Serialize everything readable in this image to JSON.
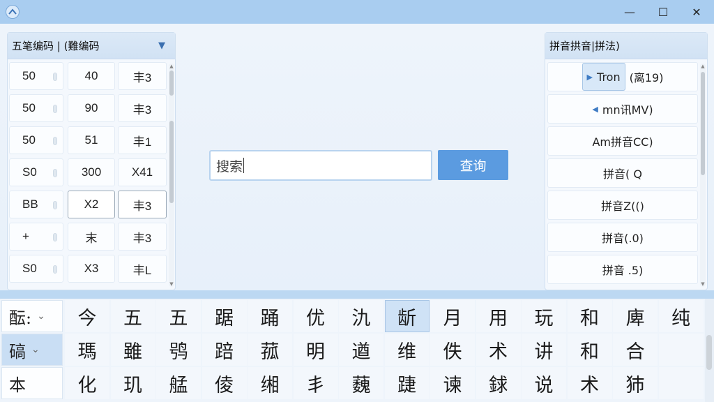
{
  "window": {
    "minimize_glyph": "—",
    "maximize_glyph": "☐",
    "close_glyph": "✕"
  },
  "left_panel": {
    "title": "五笔编码 | (難编码",
    "rows": [
      [
        "50",
        "40",
        "丰3"
      ],
      [
        "50",
        "90",
        "丰3"
      ],
      [
        "50",
        "51",
        "丰1"
      ],
      [
        "S0",
        "300",
        "X41"
      ],
      [
        "BB",
        "X2",
        "丰3"
      ],
      [
        "+",
        "末",
        "丰3"
      ],
      [
        "S0",
        "X3",
        "丰L"
      ]
    ]
  },
  "search": {
    "placeholder": "搜索",
    "button_label": "查询"
  },
  "right_panel": {
    "title": "拼音拱音|拼法)",
    "rows": [
      {
        "button": "Tron",
        "text": "(离19)",
        "arrow": "▶"
      },
      {
        "button": "",
        "text": "mn讯MV)",
        "arrow": "◀"
      },
      {
        "button": "",
        "text": "Am拼音CC)",
        "arrow": ""
      },
      {
        "button": "",
        "text": "拼音( Q",
        "arrow": ""
      },
      {
        "button": "",
        "text": "拼音Z(()",
        "arrow": ""
      },
      {
        "button": "",
        "text": "拼音(.0)",
        "arrow": ""
      },
      {
        "button": "",
        "text": "拼音 .5)",
        "arrow": ""
      }
    ]
  },
  "candidates": {
    "labels": [
      "酝:",
      "碻",
      "本"
    ],
    "rows": [
      [
        "今",
        "五",
        "五",
        "踞",
        "踊",
        "优",
        "氿",
        "龂",
        "月",
        "用",
        "玩",
        "和",
        "庳",
        "纯"
      ],
      [
        "瑪",
        "雖",
        "鸮",
        "踣",
        "菰",
        "明",
        "遒",
        "维",
        "佚",
        "术",
        "讲",
        "和",
        "合",
        ""
      ],
      [
        "化",
        "玑",
        "艋",
        "倰",
        "缃",
        "丯",
        "蘶",
        "踕",
        "谏",
        "銶",
        "说",
        "术",
        "犻",
        ""
      ]
    ]
  }
}
